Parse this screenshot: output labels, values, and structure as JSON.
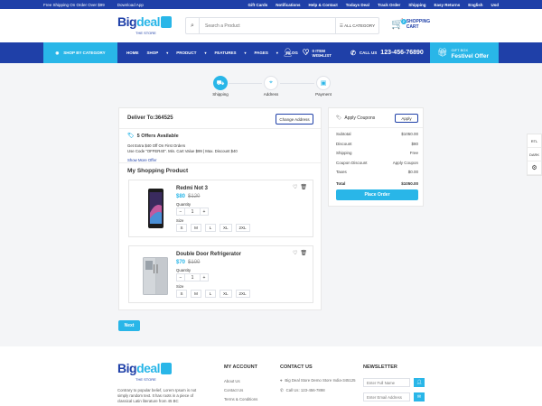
{
  "topbar": {
    "shipping": "Free Shipping On Order Over $99",
    "app": "Download App",
    "links": [
      "Gift Cards",
      "Notifications",
      "Help & Contact",
      "Todays Deal",
      "Track Order",
      "Shipping",
      "Easy Returns",
      "English",
      "Usd"
    ]
  },
  "header": {
    "logo_word_a": "Big",
    "logo_word_b": "deal",
    "logo_sub": "THE STORE",
    "search_placeholder": "Search a Product",
    "category": "ALL CATEGORY",
    "cart_count": "2",
    "cart_line1": "SHOPPING",
    "cart_line2": "CART"
  },
  "nav": {
    "shop_by_category": "SHOP BY CATEGORY",
    "menu": [
      "HOME",
      "SHOP",
      "PRODUCT",
      "FEATURES",
      "PAGES",
      "BLOG"
    ],
    "wishlist_line1": "0 ITEM",
    "wishlist_line2": "WISHLIST",
    "call_label": "CALL US",
    "phone": "123-456-76890",
    "gift_line1": "GIFT BOX",
    "gift_line2": "Festivel Offer"
  },
  "steps": [
    {
      "label": "Shipping",
      "active": true,
      "icon": "truck-icon"
    },
    {
      "label": "Address",
      "active": false,
      "icon": "map-pin-icon"
    },
    {
      "label": "Payment",
      "active": false,
      "icon": "wallet-icon"
    }
  ],
  "checkout": {
    "deliver_to": "Deliver To:364525",
    "change_address": "Change Address",
    "offers_title": "5 Offers Available",
    "offer_line1": "Get Extra $40 Off On First Orders",
    "offer_line2": "Use Code \"OFFER40\". Min. Cart Value $99 | Max. Discount $40",
    "show_more": "Show More Offer",
    "my_shopping": "My Shopping Product",
    "quantity_label": "Quantity",
    "size_label": "Size",
    "products": [
      {
        "name": "Redmi Not 3",
        "price": "$80",
        "old_price": "$120",
        "qty": "1",
        "sizes": [
          "S",
          "M",
          "L",
          "XL",
          "2XL"
        ]
      },
      {
        "name": "Double Door Refrigerator",
        "price": "$70",
        "old_price": "$100",
        "qty": "1",
        "sizes": [
          "S",
          "M",
          "L",
          "XL",
          "2XL"
        ]
      }
    ],
    "next": "Next"
  },
  "summary": {
    "apply_coupons": "Apply Coupons",
    "apply": "Apply",
    "rows": [
      {
        "label": "Subtotal",
        "value": "$1050.00"
      },
      {
        "label": "Discount",
        "value": "$80"
      },
      {
        "label": "Shipping",
        "value": "Free"
      },
      {
        "label": "Coupon Discount",
        "value": "Apply Coupon"
      },
      {
        "label": "Taxes",
        "value": "$0.00"
      }
    ],
    "total_label": "Total",
    "total_value": "$1050.00",
    "place_order": "Place Order"
  },
  "side": [
    "RTL",
    "DARK",
    "⚙"
  ],
  "footer": {
    "desc": "Contrary to popular belief, Lorem Ipsum is not simply random text. It has roots in a piece of classical Latin literature from 45 BC",
    "my_account": "MY ACCOUNT",
    "account_items": [
      "About Us",
      "Contact Us",
      "Terms & Conditions"
    ],
    "contact_us": "CONTACT US",
    "contact_items": [
      "Big Deal Store Demo Store India-345125",
      "Call Us: 123-456-7898"
    ],
    "newsletter": "NEWSLETTER",
    "full_name": "Enter Full Name",
    "email": "Enter Email Address"
  },
  "colors": {
    "primary": "#1f40a8",
    "accent": "#29b6e8"
  }
}
